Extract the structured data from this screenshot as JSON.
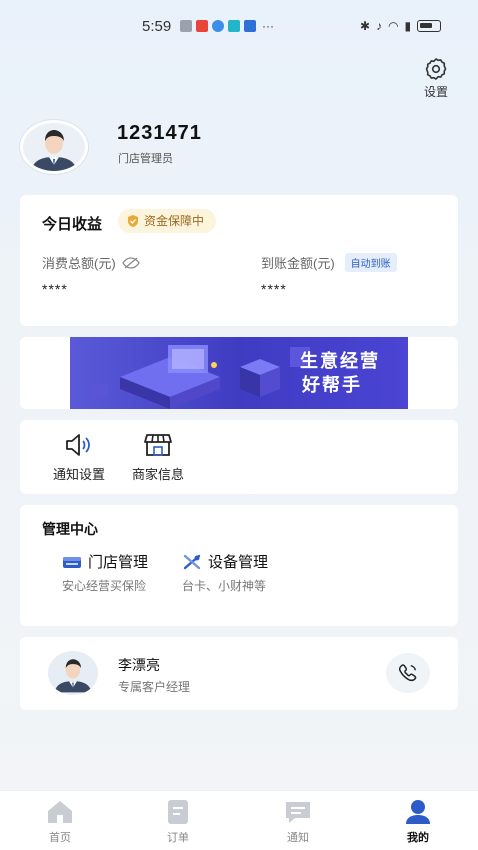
{
  "status_bar": {
    "time": "5:59",
    "more": "···"
  },
  "settings": {
    "label": "设置"
  },
  "profile": {
    "user_id": "1231471",
    "role": "门店管理员"
  },
  "earnings": {
    "title": "今日收益",
    "guarantee": "资金保障中",
    "total_label": "消费总额(元)",
    "received_label": "到账金额(元)",
    "auto_tag": "自动到账",
    "total_value": "****",
    "received_value": "****"
  },
  "banner": {
    "line1": "生意经营",
    "line2": "好帮手"
  },
  "tools": [
    {
      "label": "通知设置",
      "icon": "speaker-icon"
    },
    {
      "label": "商家信息",
      "icon": "store-icon"
    }
  ],
  "management": {
    "title": "管理中心",
    "items": [
      {
        "label": "门店管理",
        "sub": "安心经营买保险",
        "icon": "store-manage-icon"
      },
      {
        "label": "设备管理",
        "sub": "台卡、小财神等",
        "icon": "tools-icon"
      }
    ]
  },
  "manager": {
    "name": "李漂亮",
    "role": "专属客户经理"
  },
  "tabs": [
    {
      "label": "首页",
      "icon": "home-icon",
      "active": false
    },
    {
      "label": "订单",
      "icon": "order-icon",
      "active": false
    },
    {
      "label": "通知",
      "icon": "message-icon",
      "active": false
    },
    {
      "label": "我的",
      "icon": "user-icon",
      "active": true
    }
  ],
  "colors": {
    "accent": "#2d5cc8",
    "guarantee_bg": "#fdf4de",
    "banner": "#4a44cc"
  }
}
